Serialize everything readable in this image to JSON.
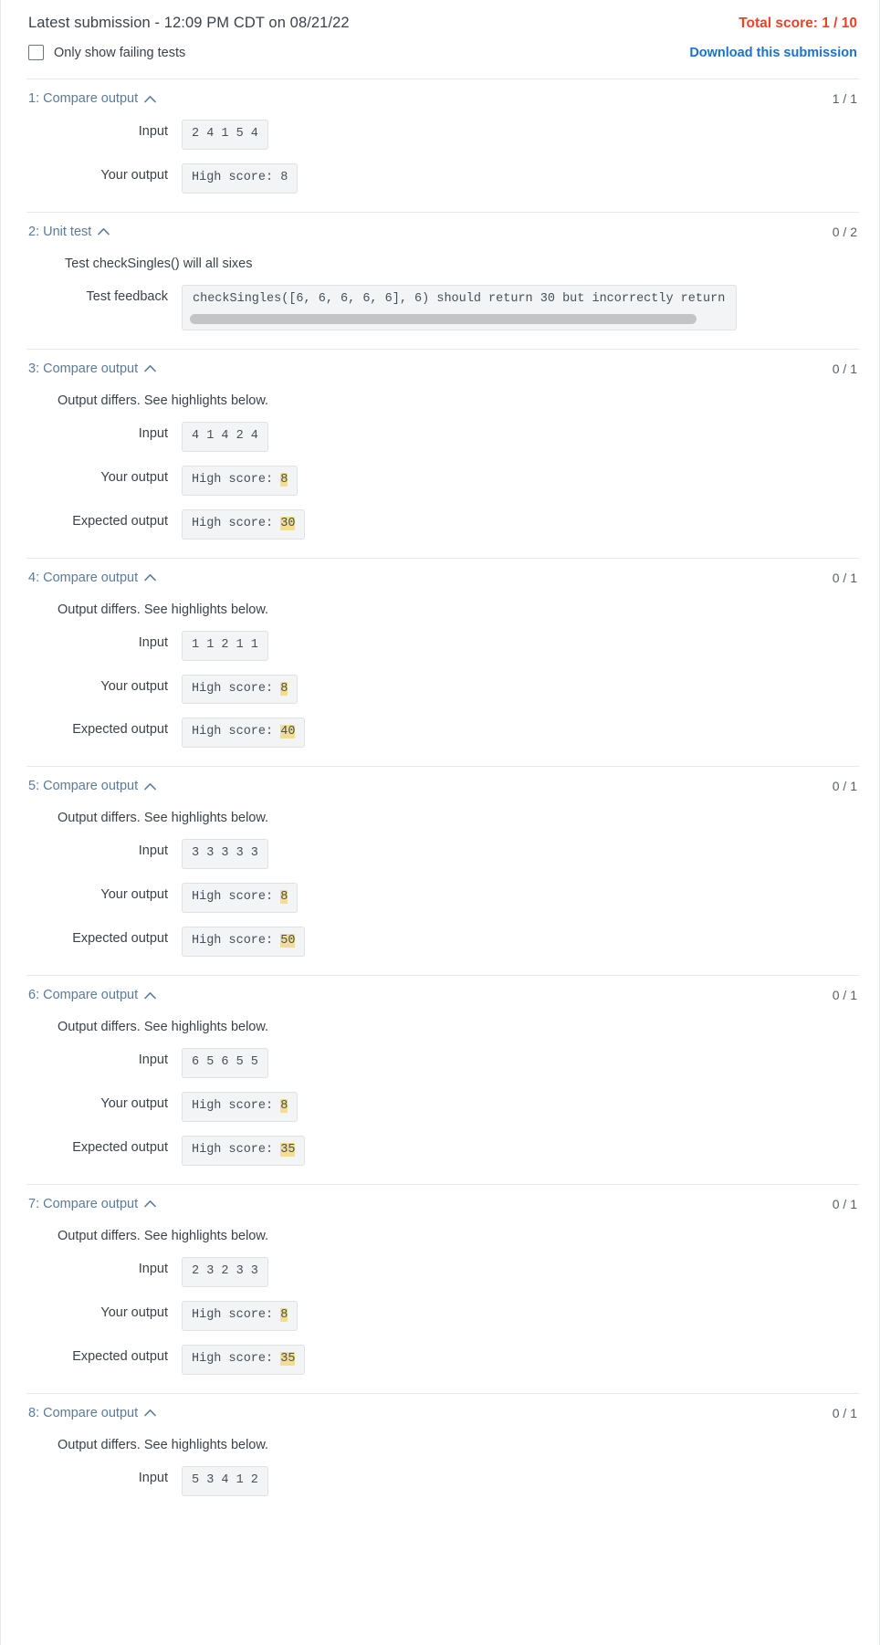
{
  "header": {
    "submission_title": "Latest submission - 12:09 PM CDT on 08/21/22",
    "total_score": "Total score: 1 / 10",
    "only_failing_label": "Only show failing tests",
    "download_label": "Download this submission"
  },
  "labels": {
    "input": "Input",
    "your_output": "Your output",
    "expected_output": "Expected output",
    "test_feedback": "Test feedback",
    "diff_note": "Output differs. See highlights below."
  },
  "colors": {
    "score_red": "#e8442a",
    "link_blue": "#1a73c8",
    "test_title_blue": "#5b7b9a",
    "highlight_gold": "#f3dd95",
    "box_bg": "#f3f4f5",
    "box_border": "#dfe1e3"
  },
  "tests": [
    {
      "title": "1: Compare output",
      "score": "1 / 1",
      "type": "compare",
      "diff_note": "",
      "input": "2 4 1 5 4",
      "your_output_prefix": "High score: 8",
      "your_output_hl": "",
      "expected_output_prefix": "",
      "expected_output_hl": ""
    },
    {
      "title": "2: Unit test",
      "score": "0 / 2",
      "type": "unit",
      "description": "Test checkSingles() will all sixes",
      "feedback": "checkSingles([6, 6, 6, 6, 6], 6) should return 30 but incorrectly return"
    },
    {
      "title": "3: Compare output",
      "score": "0 / 1",
      "type": "compare",
      "diff_note": "Output differs. See highlights below.",
      "input": "4 1 4 2 4",
      "your_output_prefix": "High score: ",
      "your_output_hl": "8",
      "expected_output_prefix": "High score: ",
      "expected_output_hl": "30"
    },
    {
      "title": "4: Compare output",
      "score": "0 / 1",
      "type": "compare",
      "diff_note": "Output differs. See highlights below.",
      "input": "1 1 2 1 1",
      "your_output_prefix": "High score: ",
      "your_output_hl": "8",
      "expected_output_prefix": "High score: ",
      "expected_output_hl": "40"
    },
    {
      "title": "5: Compare output",
      "score": "0 / 1",
      "type": "compare",
      "diff_note": "Output differs. See highlights below.",
      "input": "3 3 3 3 3",
      "your_output_prefix": "High score: ",
      "your_output_hl": "8",
      "expected_output_prefix": "High score: ",
      "expected_output_hl": "50"
    },
    {
      "title": "6: Compare output",
      "score": "0 / 1",
      "type": "compare",
      "diff_note": "Output differs. See highlights below.",
      "input": "6 5 6 5 5",
      "your_output_prefix": "High score: ",
      "your_output_hl": "8",
      "expected_output_prefix": "High score: ",
      "expected_output_hl": "35"
    },
    {
      "title": "7: Compare output",
      "score": "0 / 1",
      "type": "compare",
      "diff_note": "Output differs. See highlights below.",
      "input": "2 3 2 3 3",
      "your_output_prefix": "High score: ",
      "your_output_hl": "8",
      "expected_output_prefix": "High score: ",
      "expected_output_hl": "35"
    },
    {
      "title": "8: Compare output",
      "score": "0 / 1",
      "type": "compare-partial",
      "diff_note": "Output differs. See highlights below.",
      "input": "5 3 4 1 2",
      "your_output_prefix": "",
      "your_output_hl": "",
      "expected_output_prefix": "",
      "expected_output_hl": ""
    }
  ]
}
